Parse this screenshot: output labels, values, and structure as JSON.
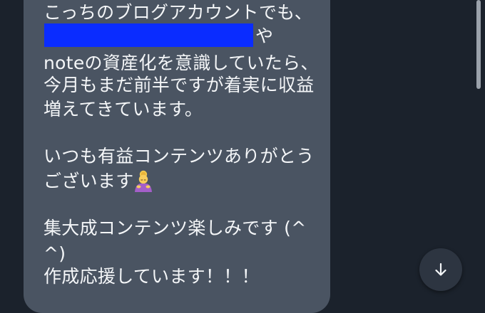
{
  "message": {
    "lines": [
      "こっちのブログアカウントでも、",
      "",
      "noteの資産化を意識していたら、",
      "今月もまだ前半ですが着実に収益",
      "増えてきています。",
      "いつも有益コンテンツありがとう",
      "ございます",
      "集大成コンテンツ楽しみです (^",
      "^)",
      "作成応援しています！！！"
    ],
    "after_redaction": "や",
    "emoji": "woman-bowing-emoji"
  },
  "controls": {
    "scroll_down_icon": "arrow-down-icon"
  },
  "colors": {
    "background": "#1b222c",
    "bubble": "#4a5462",
    "text": "#f4f6f8",
    "redaction": "#0a2cff",
    "button": "#2d3541"
  }
}
